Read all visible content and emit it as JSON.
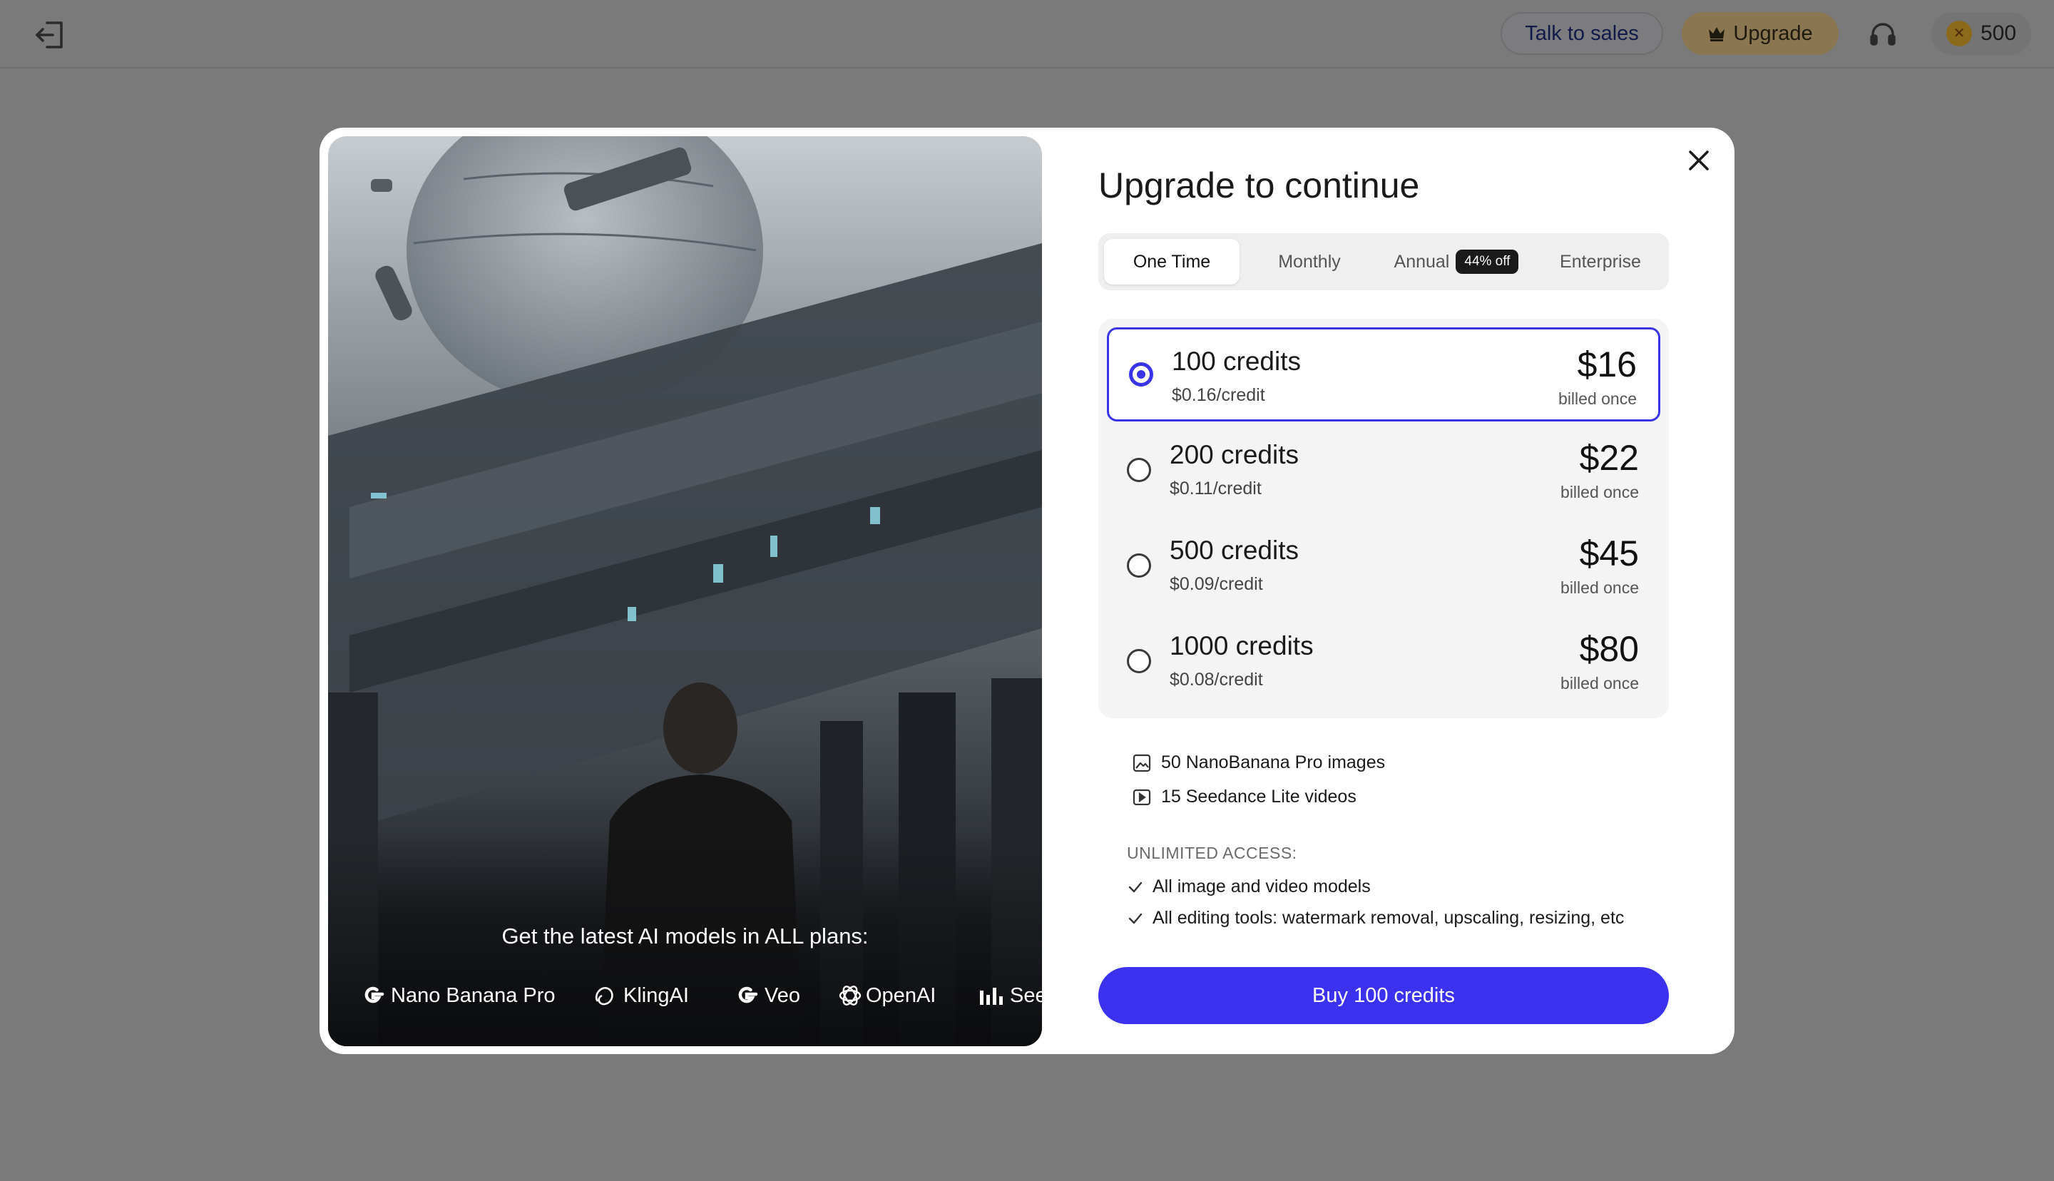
{
  "header": {
    "exit_icon": "exit-icon",
    "talk_to_sales": "Talk to sales",
    "upgrade": "Upgrade",
    "support_icon": "headphones-icon",
    "credits": "500"
  },
  "modal": {
    "hero": {
      "caption": "Get the latest AI models in ALL plans:",
      "models": [
        "Nano Banana Pro",
        "KlingAI",
        "Veo",
        "OpenAI",
        "See"
      ]
    },
    "title": "Upgrade to continue",
    "tabs": [
      {
        "label": "One Time",
        "active": true
      },
      {
        "label": "Monthly",
        "active": false
      },
      {
        "label": "Annual",
        "badge": "44% off",
        "active": false
      },
      {
        "label": "Enterprise",
        "active": false
      }
    ],
    "options": [
      {
        "credits": "100 credits",
        "rate": "$0.16/credit",
        "price": "$16",
        "billing": "billed once",
        "selected": true
      },
      {
        "credits": "200 credits",
        "rate": "$0.11/credit",
        "price": "$22",
        "billing": "billed once",
        "selected": false
      },
      {
        "credits": "500 credits",
        "rate": "$0.09/credit",
        "price": "$45",
        "billing": "billed once",
        "selected": false
      },
      {
        "credits": "1000 credits",
        "rate": "$0.08/credit",
        "price": "$80",
        "billing": "billed once",
        "selected": false
      }
    ],
    "features": [
      {
        "icon": "image-icon",
        "text": "50 NanoBanana Pro images"
      },
      {
        "icon": "video-icon",
        "text": "15 Seedance Lite videos"
      }
    ],
    "unlimited_label": "UNLIMITED ACCESS:",
    "unlimited": [
      "All image and video models",
      "All editing tools: watermark removal, upscaling, resizing, etc"
    ],
    "buy_button": "Buy 100 credits"
  },
  "colors": {
    "accent": "#3b32f0",
    "overlay": "#7a7a7a",
    "upgrade_gold": "#8a7650"
  }
}
